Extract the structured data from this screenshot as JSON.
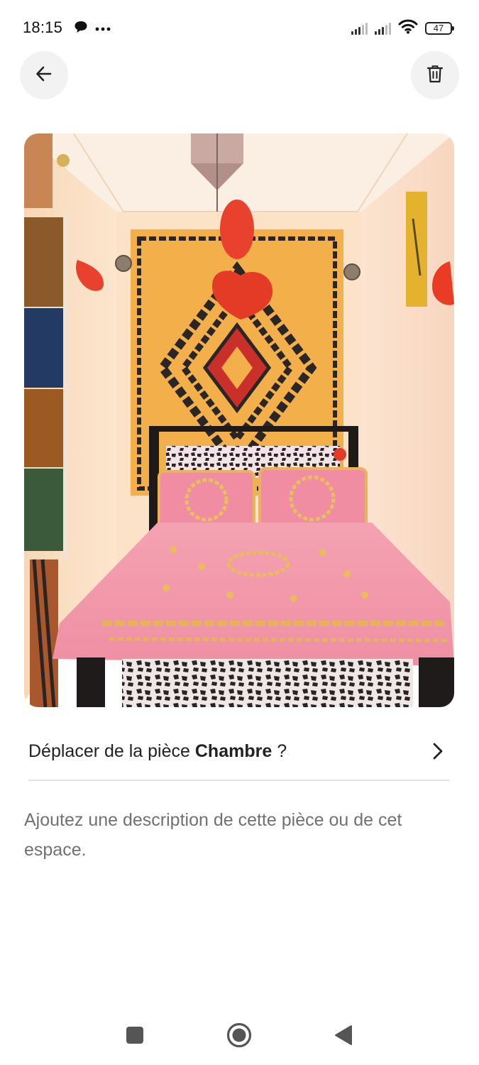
{
  "status_bar": {
    "time": "18:15",
    "battery": "47",
    "icons": [
      "message-icon",
      "more-dots-icon",
      "signal-icon",
      "signal-icon",
      "wifi-icon",
      "battery-icon"
    ]
  },
  "toolbar": {
    "back_icon": "arrow-left-icon",
    "delete_icon": "trash-icon"
  },
  "photo": {
    "subject": "bedroom-photo"
  },
  "move_room": {
    "prefix": "Déplacer de la pièce",
    "room": "Chambre",
    "suffix": " ?",
    "icon": "chevron-right-icon"
  },
  "description": {
    "placeholder": "Ajoutez une description de cette pièce ou de cet espace."
  },
  "nav_bar": {
    "icons": [
      "recents-square-icon",
      "home-circle-icon",
      "back-triangle-icon"
    ]
  },
  "colors": {
    "text_primary": "#222222",
    "text_secondary": "#717171",
    "button_bg": "#f2f2f2",
    "divider": "#e4e4e4"
  }
}
